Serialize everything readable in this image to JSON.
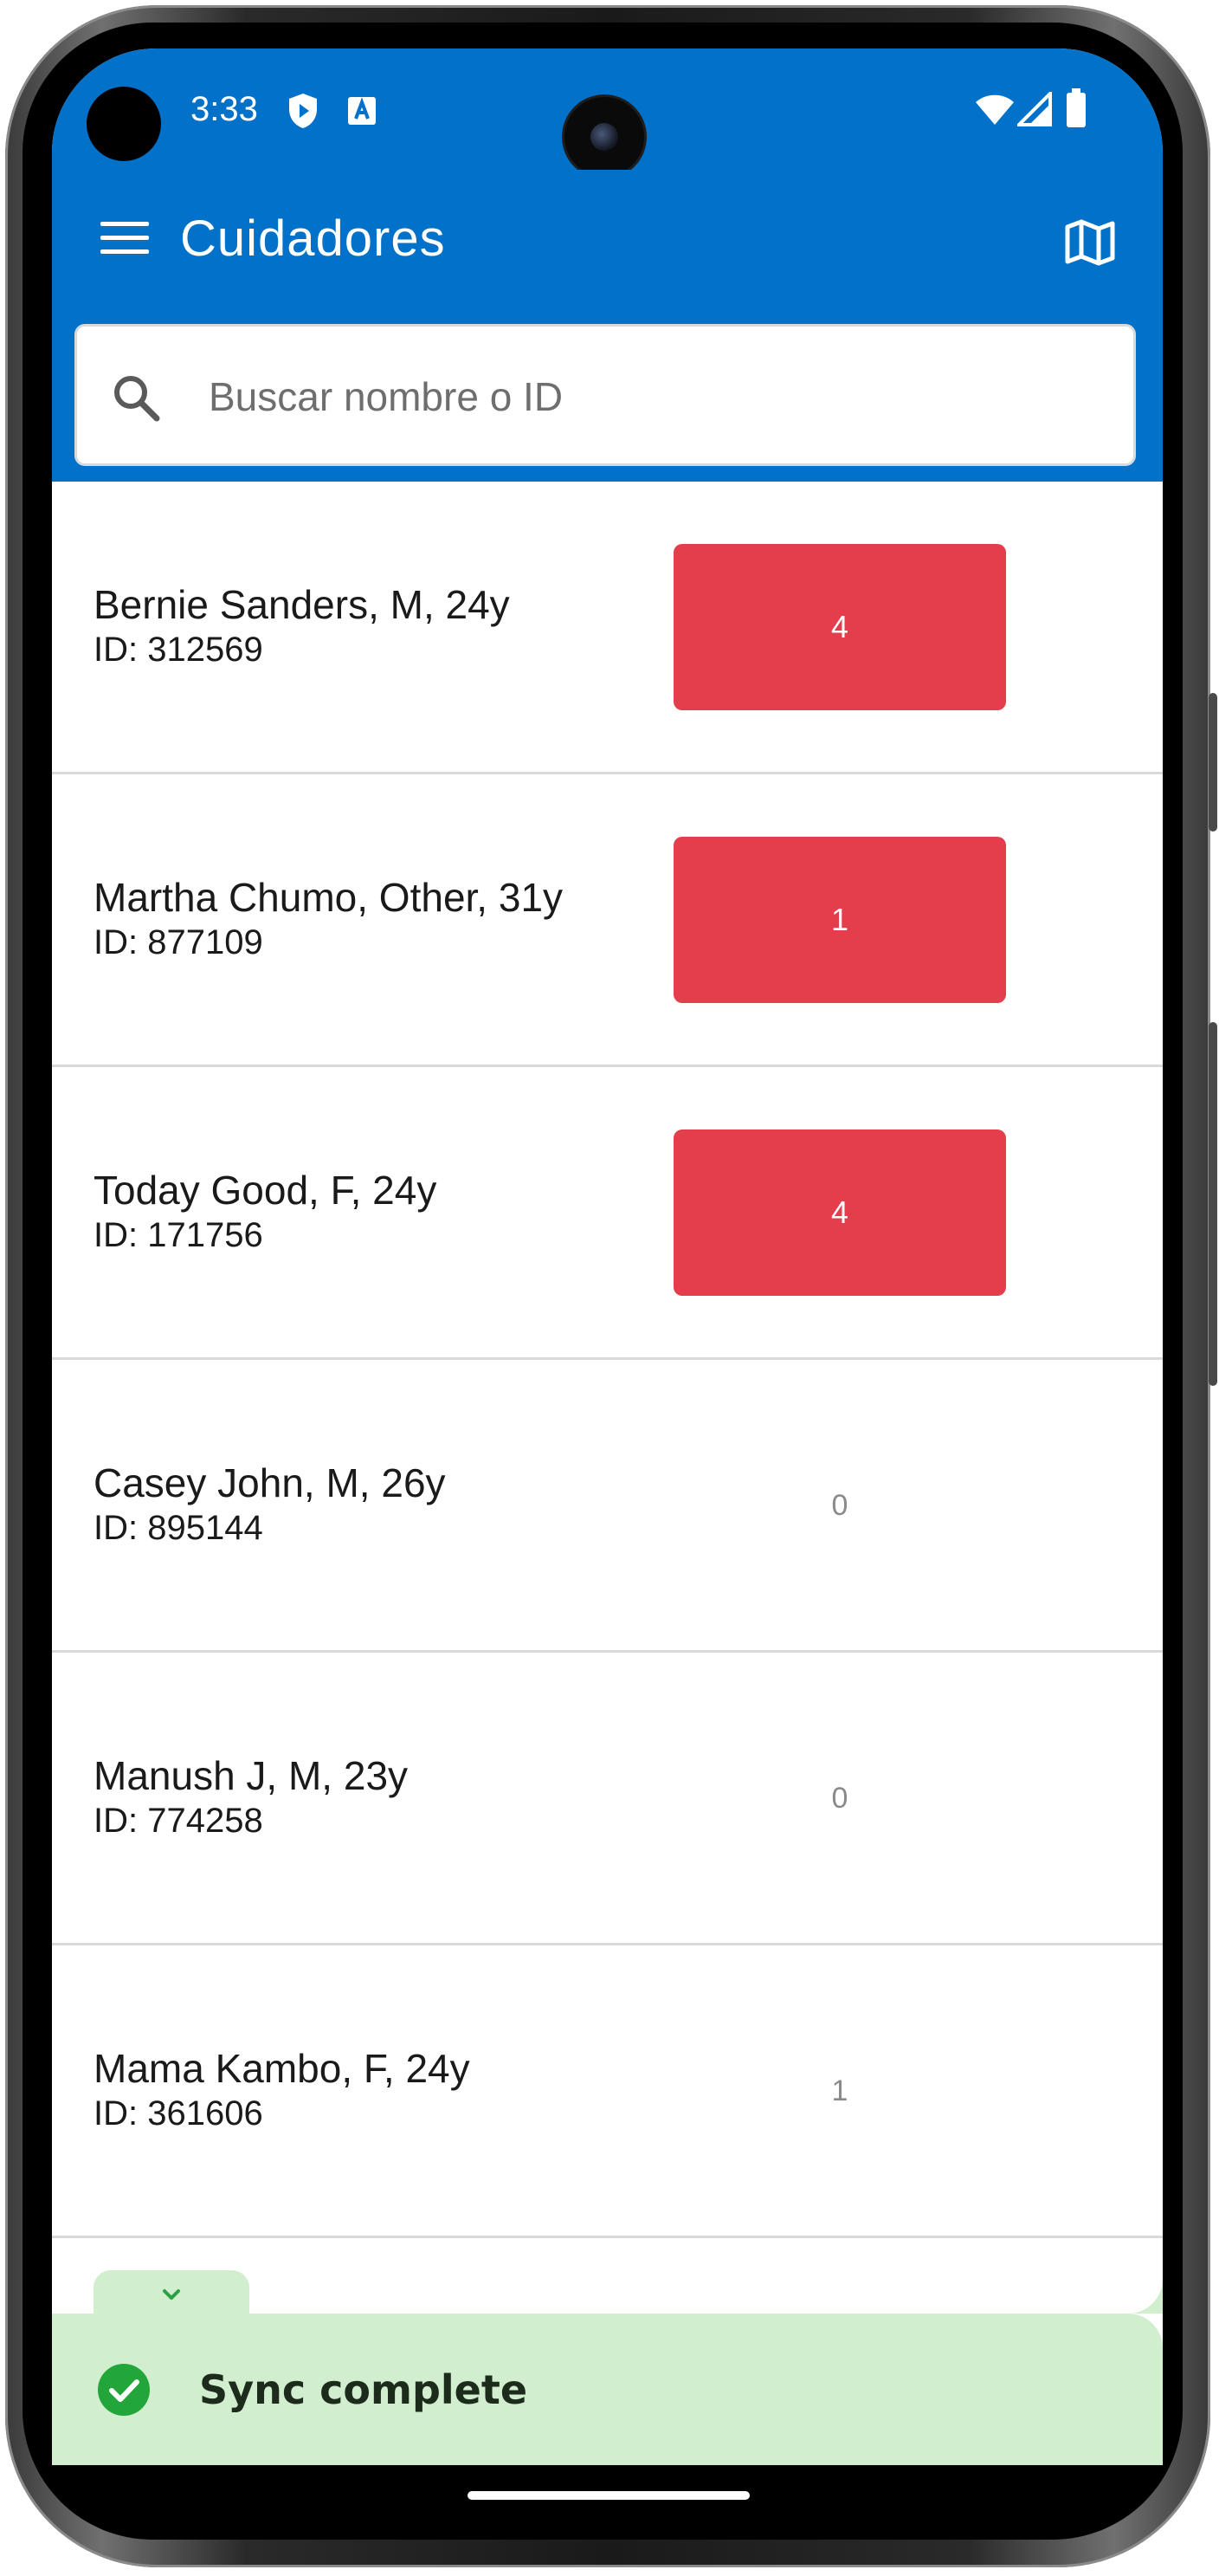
{
  "status_bar": {
    "time": "3:33",
    "icons": [
      "shield-play-icon",
      "a-notification-icon",
      "wifi-icon",
      "cellular-signal-icon",
      "battery-icon"
    ]
  },
  "app_bar": {
    "title": "Cuidadores",
    "left_icon": "menu-icon",
    "right_icon": "map-icon",
    "color": "#0171c9"
  },
  "search": {
    "placeholder": "Buscar nombre o ID",
    "value": ""
  },
  "list": {
    "rows": [
      {
        "name": "Bernie Sanders, M, 24y",
        "id": "ID: 312569",
        "count": "4",
        "highlight": true
      },
      {
        "name": "Martha Chumo, Other, 31y",
        "id": "ID: 877109",
        "count": "1",
        "highlight": true
      },
      {
        "name": "Today Good, F, 24y",
        "id": "ID: 171756",
        "count": "4",
        "highlight": true
      },
      {
        "name": "Casey John, M, 26y",
        "id": "ID: 895144",
        "count": "0",
        "highlight": false
      },
      {
        "name": "Manush J, M, 23y",
        "id": "ID: 774258",
        "count": "0",
        "highlight": false
      },
      {
        "name": "Mama Kambo, F, 24y",
        "id": "ID: 361606",
        "count": "1",
        "highlight": false
      }
    ],
    "highlight_color": "#e43d4b"
  },
  "sync": {
    "message": "Sync complete",
    "toggle_icon": "chevron-down-icon",
    "status_icon": "check-circle-icon",
    "color": "#d1eece"
  }
}
